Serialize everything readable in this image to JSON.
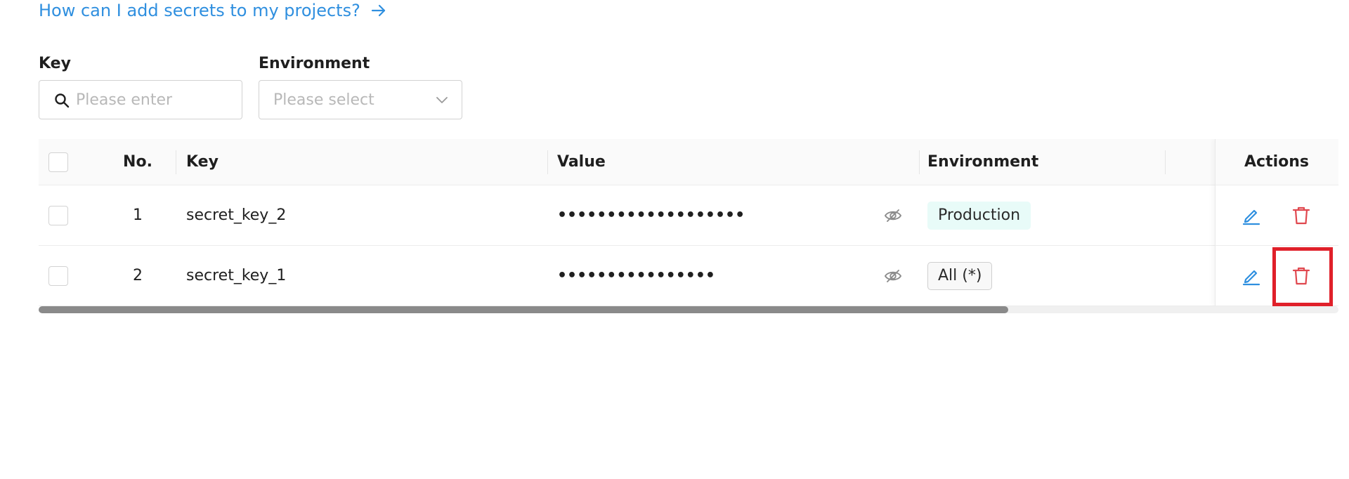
{
  "help": {
    "link_text": "How can I add secrets to my projects?",
    "arrow_icon": "arrow-right-icon"
  },
  "filters": {
    "key": {
      "label": "Key",
      "placeholder": "Please enter",
      "value": ""
    },
    "environment": {
      "label": "Environment",
      "placeholder": "Please select"
    }
  },
  "table": {
    "headers": {
      "no": "No.",
      "key": "Key",
      "value": "Value",
      "environment": "Environment",
      "actions": "Actions"
    },
    "rows": [
      {
        "no": "1",
        "key": "secret_key_2",
        "value_masked": "•••••••••••••••••••",
        "environment": "Production"
      },
      {
        "no": "2",
        "key": "secret_key_1",
        "value_masked": "••••••••••••••••",
        "environment": "All (*)"
      }
    ]
  },
  "colors": {
    "link": "#2f8fdf",
    "edit_icon": "#2f8fdf",
    "delete_icon": "#e0484f",
    "highlight": "#e0202a",
    "production_tag_bg": "#e8fbf8"
  }
}
